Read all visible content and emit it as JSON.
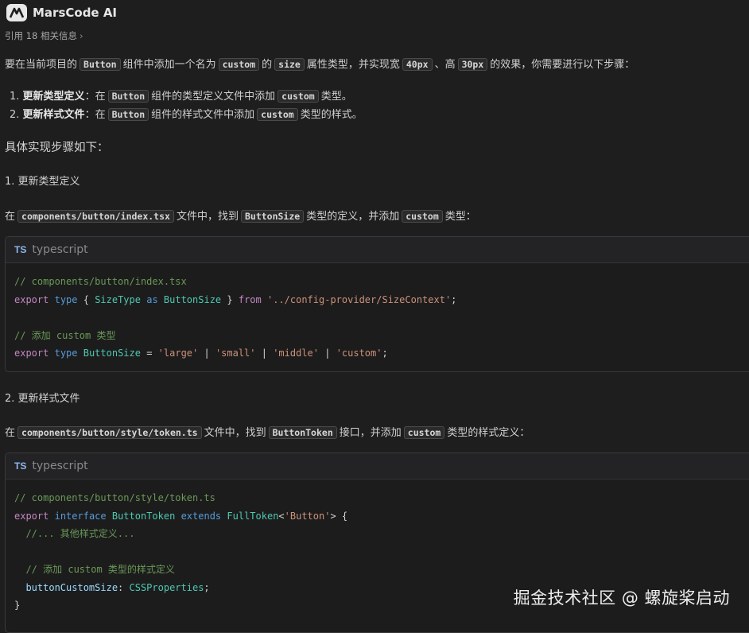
{
  "header": {
    "brand": "MarsCode AI",
    "refs": "引用 18 相关信息",
    "refs_chevron": "›"
  },
  "intro": {
    "p1": "要在当前项目的",
    "c1": "Button",
    "p2": "组件中添加一个名为",
    "c2": "custom",
    "p3": "的",
    "c3": "size",
    "p4": "属性类型，并实现宽",
    "c4": "40px",
    "p5": "、高",
    "c5": "30px",
    "p6": "的效果，你需要进行以下步骤："
  },
  "steps": [
    {
      "num": "1.",
      "bold": "更新类型定义",
      "a": "：在",
      "c1": "Button",
      "b": "组件的类型定义文件中添加",
      "c2": "custom",
      "c": "类型。"
    },
    {
      "num": "2.",
      "bold": "更新样式文件",
      "a": "：在",
      "c1": "Button",
      "b": "组件的样式文件中添加",
      "c2": "custom",
      "c": "类型的样式。"
    }
  ],
  "section_title": "具体实现步骤如下：",
  "sec1": {
    "heading": "1. 更新类型定义",
    "p1": "在",
    "c1": "components/button/index.tsx",
    "p2": "文件中，找到",
    "c2": "ButtonSize",
    "p3": "类型的定义，并添加",
    "c3": "custom",
    "p4": "类型："
  },
  "block1": {
    "icon": "TS",
    "lang": "typescript",
    "l1": "// components/button/index.tsx",
    "export": "export",
    "type": "type",
    "brace_open": "{ ",
    "SizeType": "SizeType",
    "as": "as",
    "ButtonSize": "ButtonSize",
    "brace_close": " }",
    "from": "from",
    "path": "'../config-provider/SizeContext'",
    "semi": ";",
    "c2": "// 添加 custom 类型",
    "eq": " = ",
    "large": "'large'",
    "small": "'small'",
    "middle": "'middle'",
    "custom": "'custom'",
    "pipe": " | "
  },
  "sec2": {
    "heading": "2. 更新样式文件",
    "p1": "在",
    "c1": "components/button/style/token.ts",
    "p2": "文件中，找到",
    "c2": "ButtonToken",
    "p3": "接口，并添加",
    "c3": "custom",
    "p4": "类型的样式定义："
  },
  "block2": {
    "icon": "TS",
    "lang": "typescript",
    "l1": "// components/button/style/token.ts",
    "export": "export",
    "interface": "interface",
    "ButtonToken": "ButtonToken",
    "extends": "extends",
    "FullToken": "FullToken",
    "lt": "<",
    "ButtonStr": "'Button'",
    "gt": "> {",
    "c2": "  //... 其他样式定义...",
    "c3": "  // 添加 custom 类型的样式定义",
    "prop": "buttonCustomSize",
    "colon": ": ",
    "CSSProperties": "CSSProperties",
    "semi": ";",
    "close": "}"
  },
  "watermark": "掘金技术社区 @ 螺旋桨启动"
}
